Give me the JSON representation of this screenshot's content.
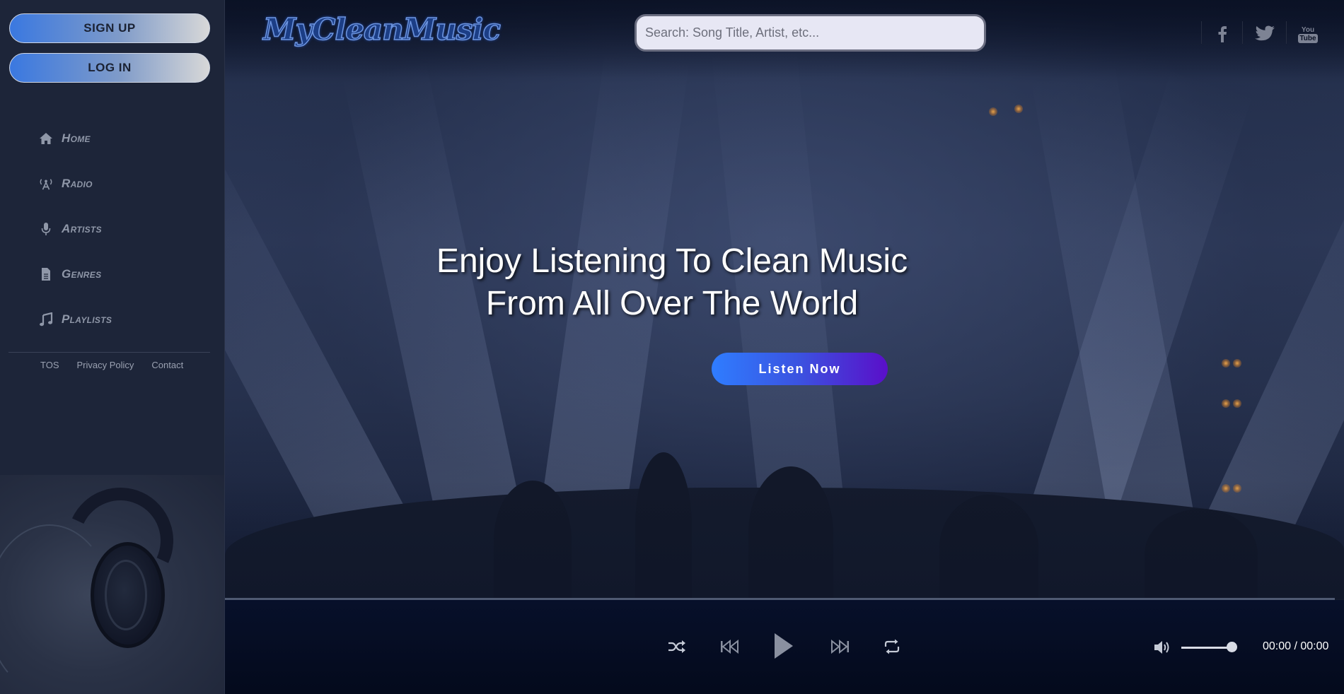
{
  "auth": {
    "signup_label": "SIGN UP",
    "login_label": "LOG IN"
  },
  "nav": {
    "items": [
      {
        "label": "Home",
        "icon": "home-icon"
      },
      {
        "label": "Radio",
        "icon": "radio-tower-icon"
      },
      {
        "label": "Artists",
        "icon": "microphone-icon"
      },
      {
        "label": "Genres",
        "icon": "document-icon"
      },
      {
        "label": "Playlists",
        "icon": "music-note-icon"
      }
    ]
  },
  "footer": {
    "tos": "TOS",
    "privacy": "Privacy Policy",
    "contact": "Contact"
  },
  "header": {
    "logo_text": "MyCleanMusic",
    "search_placeholder": "Search: Song Title, Artist, etc...",
    "social": [
      "facebook-icon",
      "twitter-icon",
      "youtube-icon"
    ],
    "youtube_text": "You Tube"
  },
  "hero": {
    "title_line1": "Enjoy Listening To Clean Music",
    "title_line2": "From All Over The World",
    "cta_label": "Listen Now"
  },
  "player": {
    "time_display": "00:00 / 00:00",
    "progress": 0,
    "volume": 0.9,
    "controls": [
      "shuffle-icon",
      "previous-icon",
      "play-icon",
      "next-icon",
      "repeat-icon",
      "volume-icon"
    ]
  },
  "colors": {
    "sidebar_bg": "#1d2539",
    "accent_blue": "#2f7dff",
    "accent_purple": "#5a0fc9",
    "player_bg": "#07102a"
  }
}
